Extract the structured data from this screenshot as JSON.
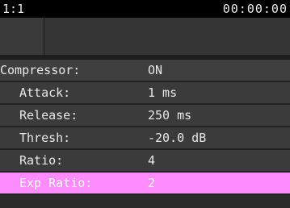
{
  "header": {
    "track": "1:1",
    "time": "00:00:00"
  },
  "rows": [
    {
      "label": "Compressor:",
      "value": "ON"
    },
    {
      "label": "Attack:",
      "value": "1 ms"
    },
    {
      "label": "Release:",
      "value": "250 ms"
    },
    {
      "label": "Thresh:",
      "value": "-20.0 dB"
    },
    {
      "label": "Ratio:",
      "value": "4"
    },
    {
      "label": "Exp Ratio:",
      "value": "2"
    }
  ],
  "selected_row": "Exp Ratio:",
  "colors": {
    "highlight": "#ff8cff",
    "background": "#3b3b3b",
    "text": "#e8e8e8"
  }
}
